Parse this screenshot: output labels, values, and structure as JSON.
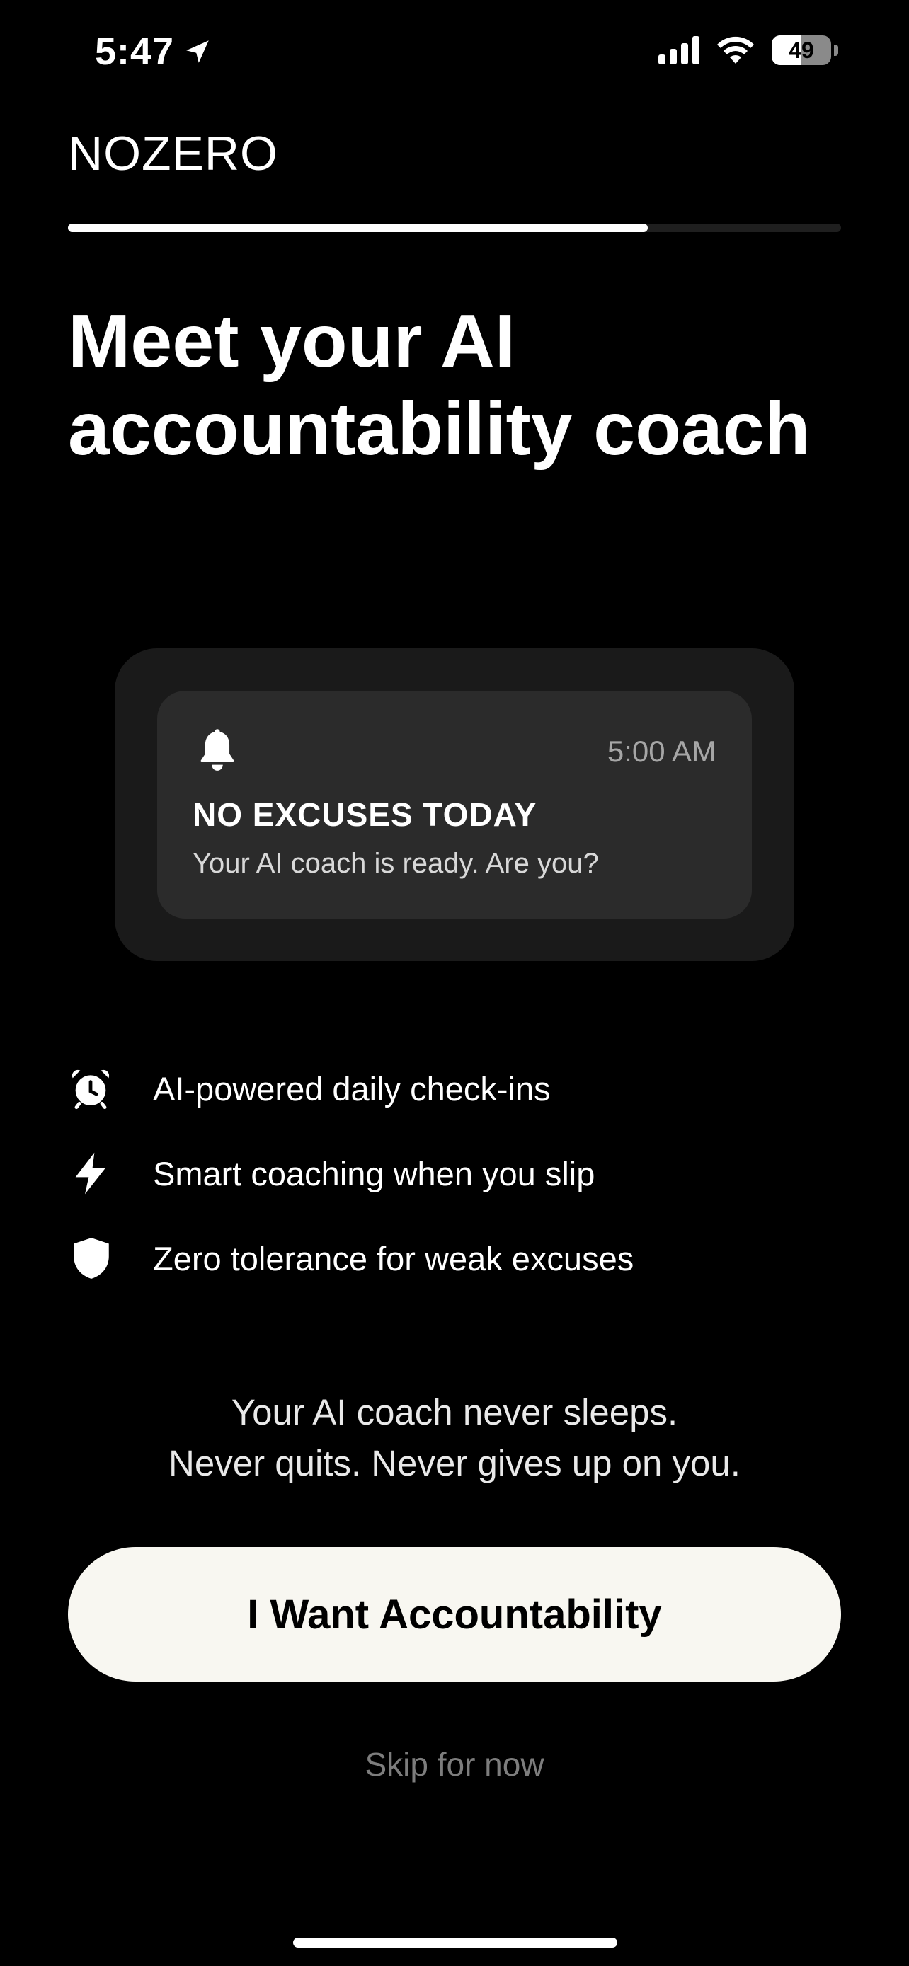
{
  "status_bar": {
    "time": "5:47",
    "battery_percent": "49",
    "battery_level": 0.49,
    "icons": [
      "location-arrow-icon",
      "cellular-signal-icon",
      "wifi-icon",
      "battery-icon"
    ]
  },
  "header": {
    "brand": "NOZERO",
    "progress_fraction": 0.75
  },
  "headline": "Meet your AI accountability coach",
  "notification": {
    "icon": "bell-icon",
    "time": "5:00 AM",
    "title": "NO EXCUSES TODAY",
    "body": "Your AI coach is ready. Are you?"
  },
  "features": [
    {
      "icon": "alarm-clock-icon",
      "label": "AI-powered daily check-ins"
    },
    {
      "icon": "lightning-bolt-icon",
      "label": "Smart coaching when you slip"
    },
    {
      "icon": "shield-icon",
      "label": "Zero tolerance for weak excuses"
    }
  ],
  "tagline": {
    "line1": "Your AI coach never sleeps.",
    "line2": "Never quits. Never gives up on you."
  },
  "cta_label": "I Want Accountability",
  "skip_label": "Skip for now",
  "colors": {
    "background": "#000000",
    "cta_background": "#f8f7f1",
    "card_outer": "#1a1a1a",
    "card_inner": "#2b2b2b",
    "muted_text": "#7d7d7d"
  }
}
